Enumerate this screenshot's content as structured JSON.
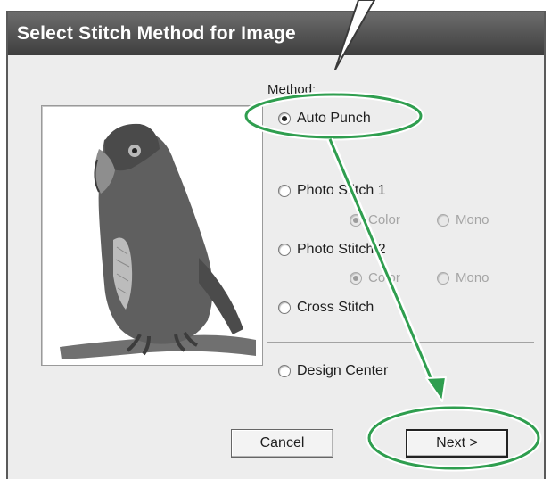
{
  "window": {
    "title": "Select Stitch Method for Image"
  },
  "method": {
    "label": "Method:",
    "options": [
      {
        "label": "Auto Punch",
        "checked": true
      },
      {
        "label": "Photo Stitch 1",
        "checked": false
      },
      {
        "label": "Photo Stitch 2",
        "checked": false
      },
      {
        "label": "Cross Stitch",
        "checked": false
      },
      {
        "label": "Design Center",
        "checked": false
      }
    ],
    "photo_stitch_1_sub": {
      "color_label": "Color",
      "mono_label": "Mono",
      "selected": "Color",
      "enabled": false
    },
    "photo_stitch_2_sub": {
      "color_label": "Color",
      "mono_label": "Mono",
      "selected": "Color",
      "enabled": false
    }
  },
  "preview": {
    "icon": "parrot-embroidery-image"
  },
  "buttons": {
    "cancel_label": "Cancel",
    "next_label": "Next >"
  },
  "annotations": {
    "highlight_color": "#2f9e4f",
    "arrow_color": "#2f9e4f"
  }
}
